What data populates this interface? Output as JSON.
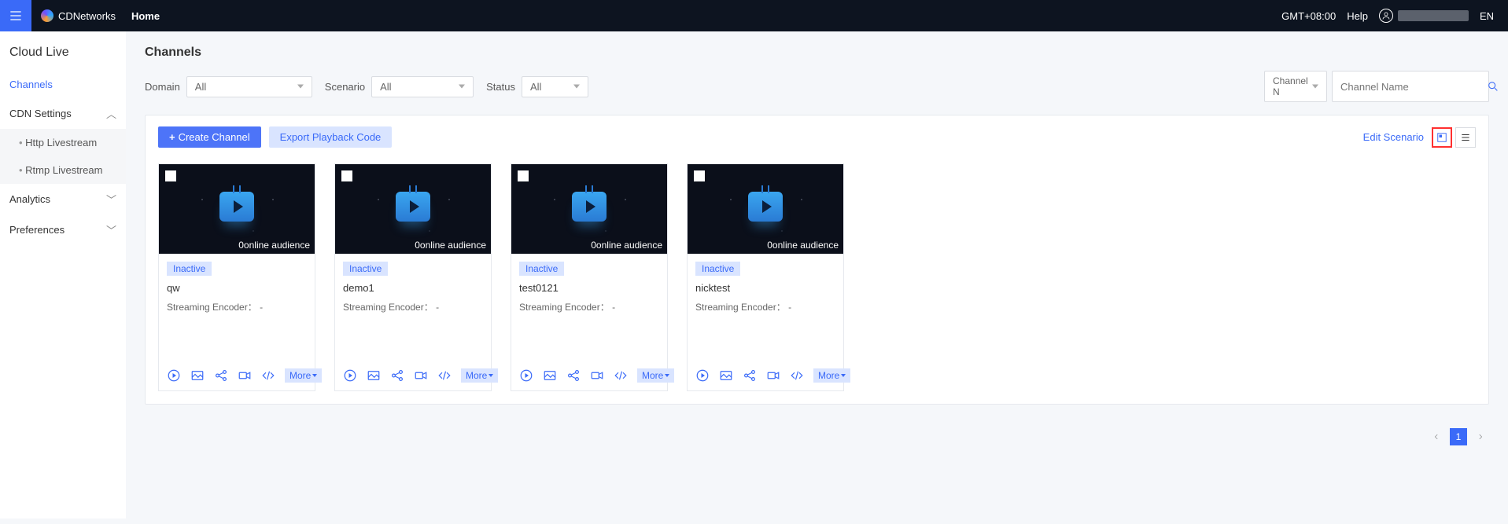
{
  "header": {
    "brand": "CDNetworks",
    "homeTab": "Home",
    "timezone": "GMT+08:00",
    "help": "Help",
    "language": "EN"
  },
  "sidebar": {
    "title": "Cloud Live",
    "items": {
      "channels": "Channels",
      "cdn": "CDN Settings",
      "http": "Http Livestream",
      "rtmp": "Rtmp Livestream",
      "analytics": "Analytics",
      "preferences": "Preferences"
    }
  },
  "page": {
    "title": "Channels"
  },
  "filters": {
    "domainLabel": "Domain",
    "domainValue": "All",
    "scenarioLabel": "Scenario",
    "scenarioValue": "All",
    "statusLabel": "Status",
    "statusValue": "All",
    "searchTypeValue": "Channel N",
    "searchPlaceholder": "Channel Name"
  },
  "toolbar": {
    "create": "Create Channel",
    "export": "Export Playback Code",
    "editScenario": "Edit Scenario"
  },
  "channels": [
    {
      "status": "Inactive",
      "name": "qw",
      "encoderLabel": "Streaming Encoder：",
      "encoderValue": "-",
      "viewers": "0online audience"
    },
    {
      "status": "Inactive",
      "name": "demo1",
      "encoderLabel": "Streaming Encoder：",
      "encoderValue": "-",
      "viewers": "0online audience"
    },
    {
      "status": "Inactive",
      "name": "test0121",
      "encoderLabel": "Streaming Encoder：",
      "encoderValue": "-",
      "viewers": "0online audience"
    },
    {
      "status": "Inactive",
      "name": "nicktest",
      "encoderLabel": "Streaming Encoder：",
      "encoderValue": "-",
      "viewers": "0online audience"
    }
  ],
  "cardActions": {
    "more": "More"
  },
  "pagination": {
    "current": "1"
  }
}
